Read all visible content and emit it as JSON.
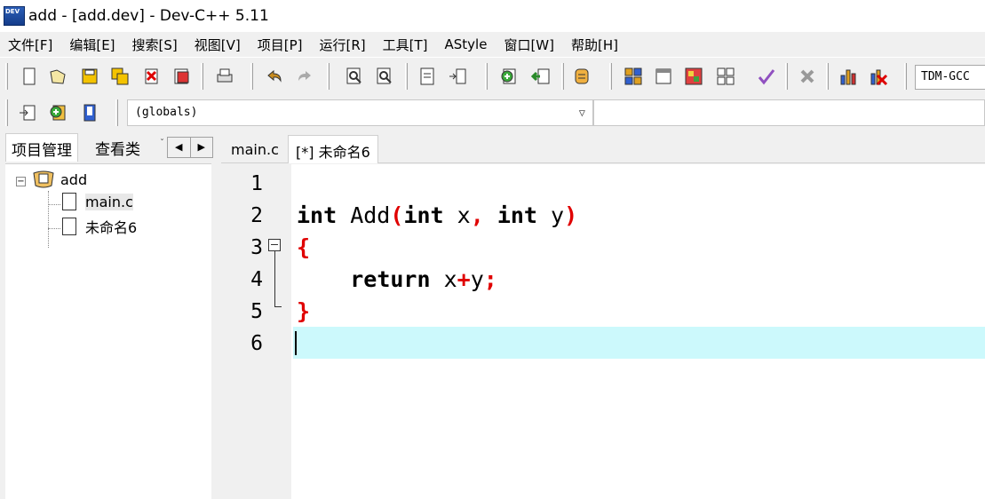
{
  "window": {
    "title": "add - [add.dev] - Dev-C++ 5.11"
  },
  "menu": [
    "文件[F]",
    "编辑[E]",
    "搜索[S]",
    "视图[V]",
    "项目[P]",
    "运行[R]",
    "工具[T]",
    "AStyle",
    "窗口[W]",
    "帮助[H]"
  ],
  "toolbar": {
    "compiler": "TDM-GCC",
    "scope": "(globals)",
    "function": ""
  },
  "left_panel": {
    "tabs": [
      "项目管理",
      "查看类"
    ],
    "tab_overflow": "ˇ",
    "scroll_left": "◀",
    "scroll_right": "▶",
    "project": "add",
    "files": [
      "main.c",
      "未命名6"
    ]
  },
  "editor": {
    "tabs": [
      "main.c",
      "[*] 未命名6"
    ],
    "line_numbers": [
      "1",
      "2",
      "3",
      "4",
      "5",
      "6"
    ],
    "code": {
      "l2": {
        "kw_int1": "int",
        "fn": " Add",
        "lparen": "(",
        "kw_int2": "int",
        "x": " x",
        "comma": ",",
        "sp": " ",
        "kw_int3": "int",
        "y": " y",
        "rparen": ")"
      },
      "l3": {
        "lbrace": "{"
      },
      "l4": {
        "indent": "    ",
        "kw_return": "return",
        "x": " x",
        "plus": "+",
        "y": "y",
        "semi": ";"
      },
      "l5": {
        "rbrace": "}"
      }
    }
  },
  "colors": {
    "current_line": "#ccf9fc",
    "punctuation": "#e00000",
    "chrome": "#f0f0f0"
  }
}
